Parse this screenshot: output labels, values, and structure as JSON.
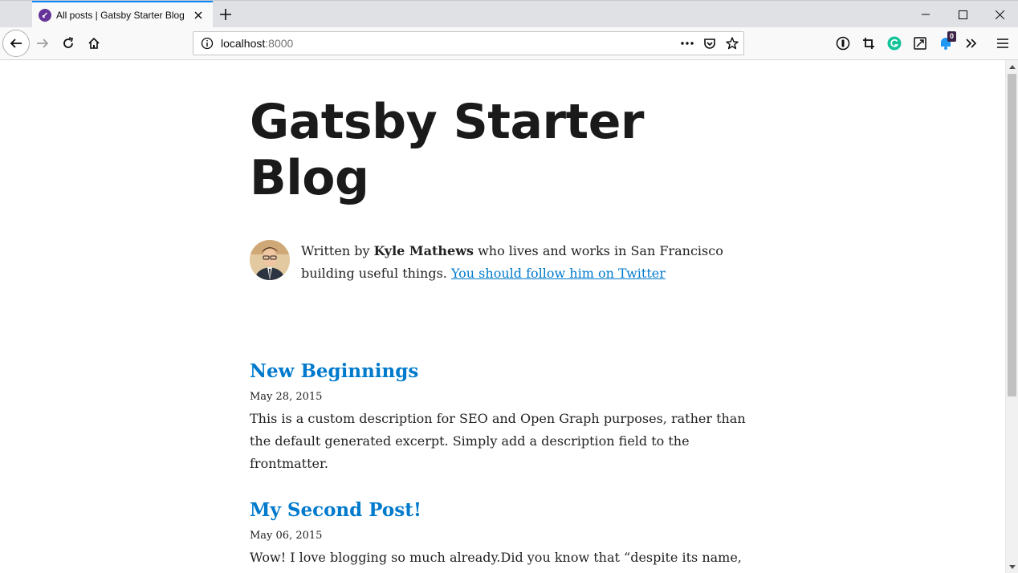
{
  "browser": {
    "tab": {
      "title": "All posts | Gatsby Starter Blog"
    },
    "url": {
      "host": "localhost",
      "port": ":8000"
    },
    "extension_badge": "0"
  },
  "blog": {
    "title": "Gatsby Starter Blog",
    "bio": {
      "prefix": "Written by",
      "author": "Kyle Mathews",
      "middle": "who lives and works in San Francisco building useful things.",
      "link_text": "You should follow him on Twitter"
    },
    "posts": [
      {
        "title": "New Beginnings",
        "date": "May 28, 2015",
        "description": "This is a custom description for SEO and Open Graph purposes, rather than the default generated excerpt. Simply add a description field to the frontmatter."
      },
      {
        "title": "My Second Post!",
        "date": "May 06, 2015",
        "description": "Wow! I love blogging so much already.Did you know that “despite its name,"
      }
    ]
  },
  "colors": {
    "link": "#007acc",
    "accent": "#0a84ff",
    "gatsby": "#663399"
  }
}
